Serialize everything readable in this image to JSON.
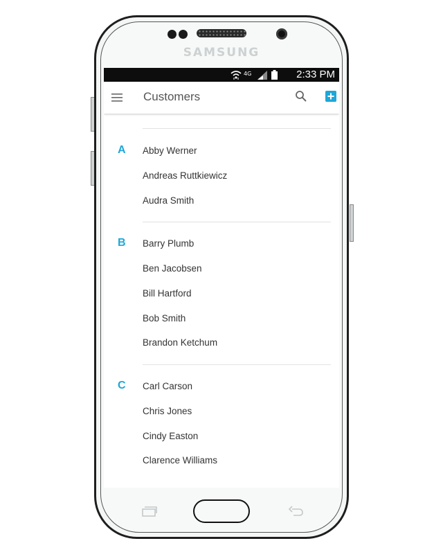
{
  "device": {
    "brand": "SAMSUNG"
  },
  "status_bar": {
    "network": "4G",
    "time": "2:33 PM"
  },
  "app_bar": {
    "title": "Customers",
    "icons": [
      "menu-icon",
      "search-icon",
      "add-icon"
    ]
  },
  "colors": {
    "accent": "#1ea7d8",
    "title_text": "#555555",
    "name_text": "#333333",
    "divider": "#e2e2e2"
  },
  "sections": [
    {
      "letter": "A",
      "names": [
        "Abby Werner",
        "Andreas Ruttkiewicz",
        "Audra Smith"
      ]
    },
    {
      "letter": "B",
      "names": [
        "Barry Plumb",
        "Ben Jacobsen",
        "Bill Hartford",
        "Bob Smith",
        "Brandon Ketchum"
      ]
    },
    {
      "letter": "C",
      "names": [
        "Carl Carson",
        "Chris Jones",
        "Cindy Easton",
        "Clarence Williams"
      ]
    }
  ]
}
